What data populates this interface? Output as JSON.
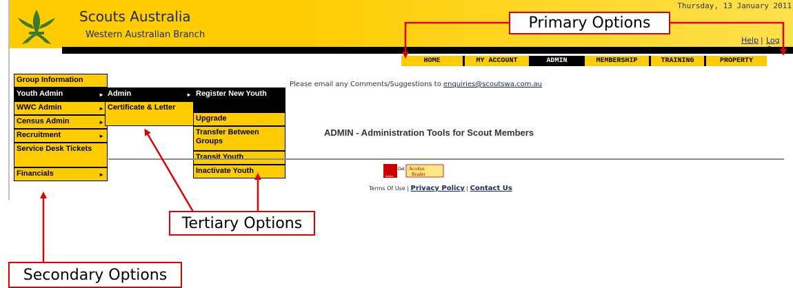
{
  "header": {
    "brand_title": "Scouts Australia",
    "brand_subtitle": "Western Australian Branch",
    "date": "Thursday, 13 January 2011",
    "help": "Help",
    "separator": "|",
    "logout": "Log Out"
  },
  "primary_nav": [
    {
      "label": "HOME",
      "active": false
    },
    {
      "label": "MY ACCOUNT",
      "active": false
    },
    {
      "label": "ADMIN",
      "active": true
    },
    {
      "label": "MEMBERSHIP",
      "active": false
    },
    {
      "label": "TRAINING",
      "active": false
    },
    {
      "label": "PROPERTY",
      "active": false
    }
  ],
  "secondary_menu": [
    {
      "label": "Group Information",
      "has_submenu": false,
      "selected": false
    },
    {
      "label": "Youth Admin",
      "has_submenu": true,
      "selected": true
    },
    {
      "label": "WWC Admin",
      "has_submenu": true,
      "selected": false
    },
    {
      "label": "Census Admin",
      "has_submenu": true,
      "selected": false
    },
    {
      "label": "Recruitment",
      "has_submenu": true,
      "selected": false
    },
    {
      "label": "Service Desk Tickets",
      "has_submenu": false,
      "selected": false
    },
    {
      "label": "Financials",
      "has_submenu": true,
      "selected": false
    }
  ],
  "tertiary_menu_1": [
    {
      "label": "Admin",
      "has_submenu": true,
      "selected": true
    },
    {
      "label": "Certificate & Letter",
      "has_submenu": false,
      "selected": false
    }
  ],
  "tertiary_menu_2": [
    {
      "label": "Register New Youth",
      "selected": true
    },
    {
      "label": "Upgrade",
      "selected": false
    },
    {
      "label": "Transfer Between Groups",
      "selected": false
    },
    {
      "label": "Transit Youth",
      "selected": false
    },
    {
      "label": "Inactivate Youth",
      "selected": false
    }
  ],
  "content": {
    "notice_text": "Please email any Comments/Suggestions to ",
    "notice_email": "enquiries@scoutswa.com.au",
    "admin_title": "ADMIN - Administration Tools for Scout Members"
  },
  "acrobat": {
    "get": "Get",
    "adobe": "Adobe",
    "acrobat": "Acrobat",
    "reader": "Reader"
  },
  "footer": {
    "terms": "Terms Of Use",
    "sep1": " | ",
    "privacy": "Privacy Policy",
    "sep2": " | ",
    "contact": "Contact Us"
  },
  "annotations": {
    "primary": "Primary Options",
    "secondary": "Secondary Options",
    "tertiary": "Tertiary Options"
  },
  "colors": {
    "accent": "#ffcc00",
    "annotation_red": "#e00000",
    "brand_navy": "#1b2a66"
  }
}
